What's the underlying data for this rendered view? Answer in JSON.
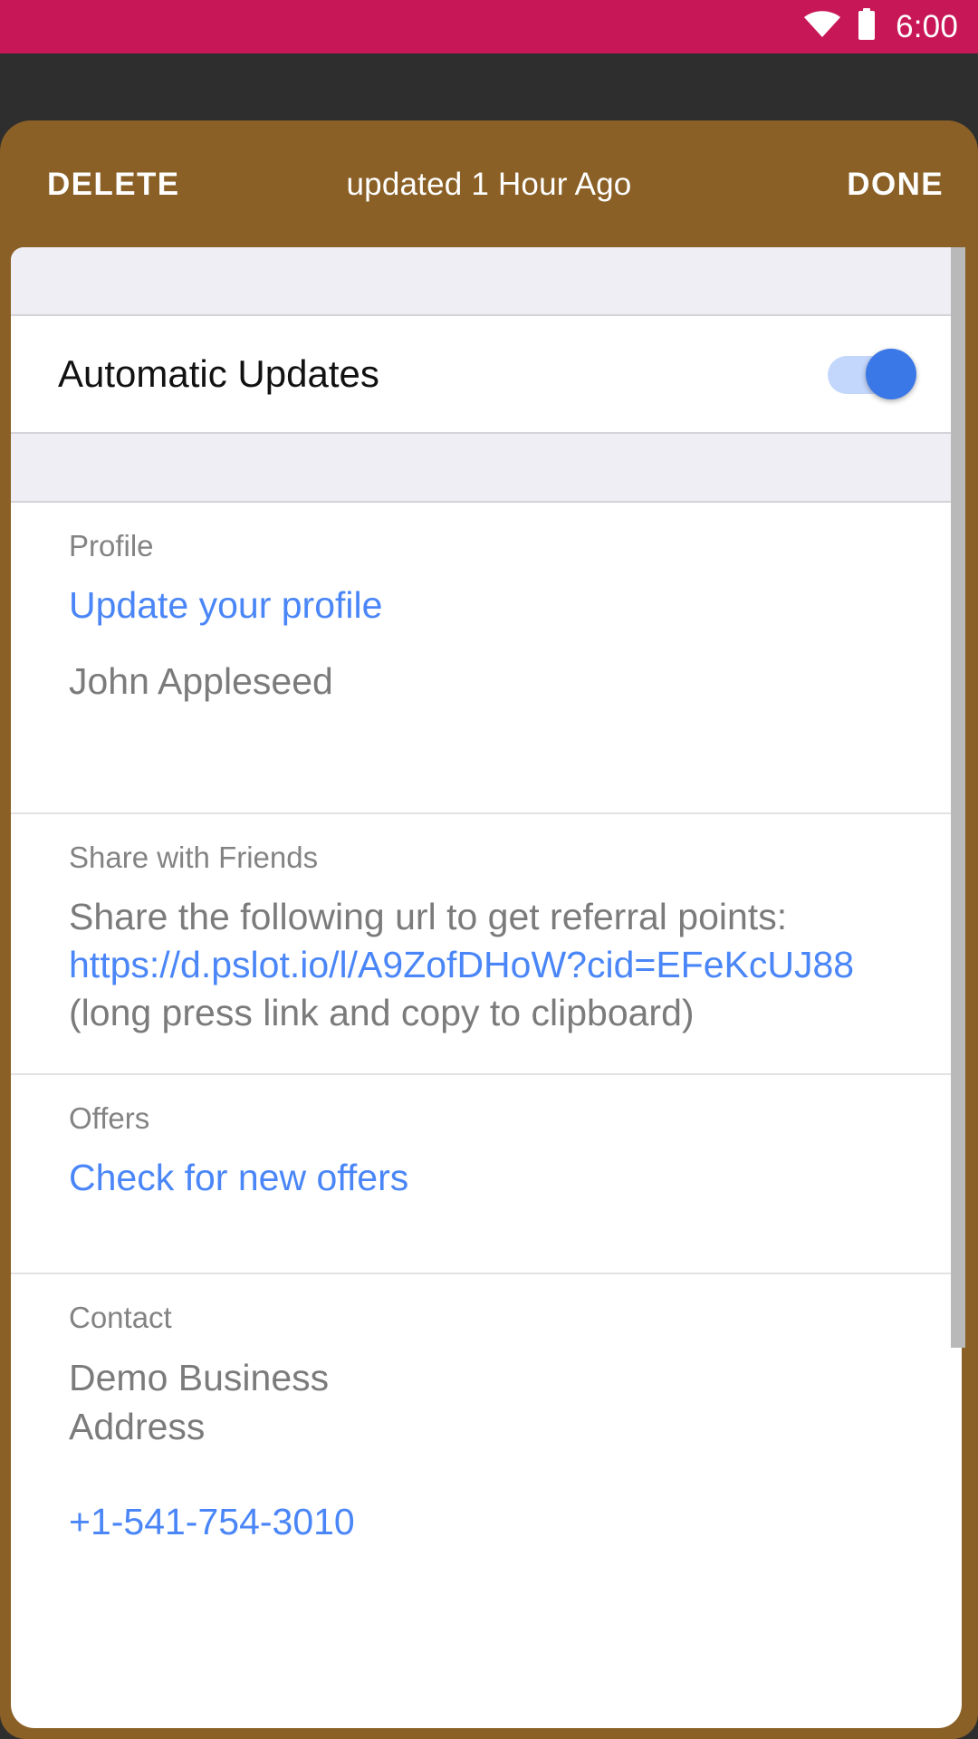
{
  "status_bar": {
    "background_color": "#c81756",
    "time": "6:00",
    "icons": [
      "wifi-icon",
      "battery-icon"
    ]
  },
  "dialog": {
    "background_color": "#8a6026",
    "header": {
      "delete_label": "DELETE",
      "title": "updated 1 Hour Ago",
      "done_label": "DONE"
    }
  },
  "content": {
    "toggle_row": {
      "label": "Automatic Updates",
      "state": "on",
      "accent_color": "#3b78e7"
    },
    "sections": [
      {
        "label": "Profile",
        "link": "Update your profile",
        "value": "John Appleseed"
      },
      {
        "label": "Share with Friends",
        "intro": "Share the following url to get referral points:",
        "url": "https://d.pslot.io/l/A9ZofDHoW?cid=EFeKcUJ88",
        "hint": "(long press link and copy to clipboard)"
      },
      {
        "label": "Offers",
        "link": "Check for new offers"
      },
      {
        "label": "Contact",
        "business_name": "Demo Business",
        "address": "Address",
        "phone": "+1-541-754-3010"
      }
    ]
  },
  "colors": {
    "link": "#4a86f7",
    "muted_text": "#7b7b7b",
    "label_text": "#838383",
    "brand_brown": "#8a6026",
    "status_pink": "#c81756"
  }
}
